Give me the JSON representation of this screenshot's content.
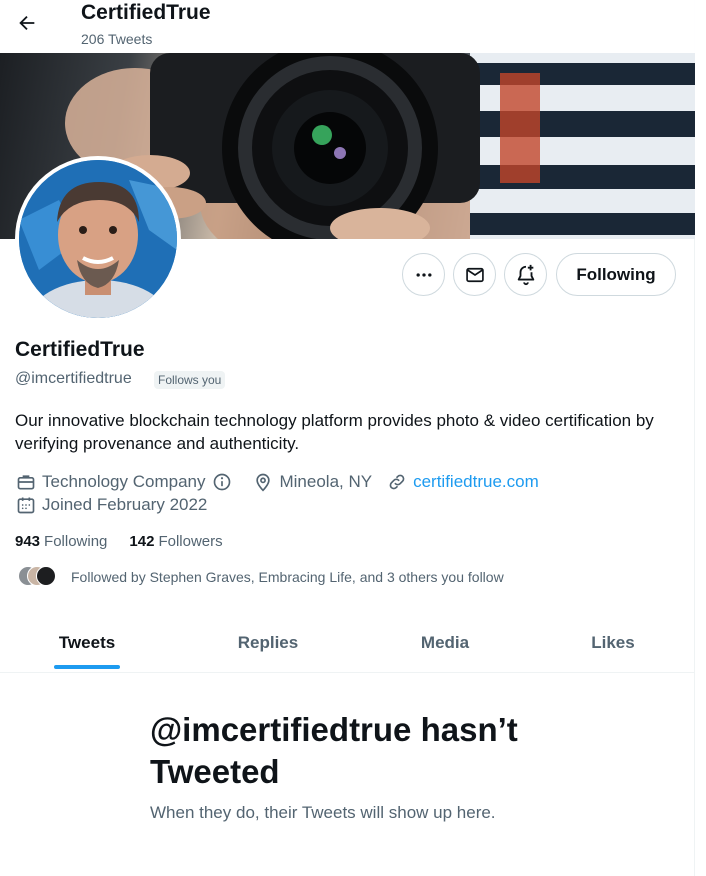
{
  "header": {
    "title": "CertifiedTrue",
    "tweet_count": "206 Tweets"
  },
  "profile": {
    "display_name": "CertifiedTrue",
    "handle": "@imcertifiedtrue",
    "follows_you_badge": "Follows you",
    "bio": "Our innovative blockchain technology platform provides photo & video certification by verifying provenance and authenticity.",
    "category": "Technology Company",
    "location": "Mineola, NY",
    "website": "certifiedtrue.com",
    "joined": "Joined February 2022",
    "following_count": "943",
    "following_label": "Following",
    "followers_count": "142",
    "followers_label": "Followers",
    "followed_by": "Followed by Stephen Graves, Embracing Life, and 3 others you follow"
  },
  "actions": {
    "more_icon": "more-horizontal-icon",
    "message_icon": "envelope-icon",
    "notify_icon": "bell-plus-icon",
    "follow_label": "Following"
  },
  "tabs": [
    {
      "label": "Tweets",
      "active": true
    },
    {
      "label": "Replies",
      "active": false
    },
    {
      "label": "Media",
      "active": false
    },
    {
      "label": "Likes",
      "active": false
    }
  ],
  "empty_state": {
    "title": "@imcertifiedtrue hasn’t Tweeted",
    "subtitle": "When they do, their Tweets will show up here."
  },
  "colors": {
    "accent": "#1d9bf0",
    "text": "#0f1419",
    "secondary": "#536471",
    "border": "#cfd9de"
  }
}
